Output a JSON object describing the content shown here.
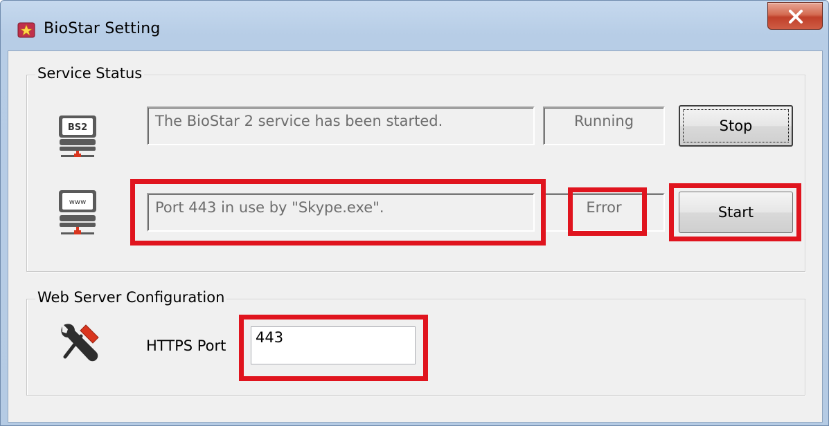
{
  "window": {
    "title": "BioStar Setting",
    "close_label": "x"
  },
  "service_status": {
    "legend": "Service Status",
    "bs2": {
      "icon_label": "BS2",
      "message": "The BioStar 2 service has been started.",
      "status": "Running",
      "button": "Stop"
    },
    "web": {
      "icon_label": "www",
      "message": "Port 443 in use by \"Skype.exe\".",
      "status": "Error",
      "button": "Start"
    }
  },
  "web_server": {
    "legend": "Web Server Configuration",
    "https_port_label": "HTTPS Port",
    "https_port_value": "443"
  },
  "colors": {
    "highlight": "#e0141e",
    "server_icon": "#5a5a5a",
    "server_accent": "#d9351e"
  }
}
